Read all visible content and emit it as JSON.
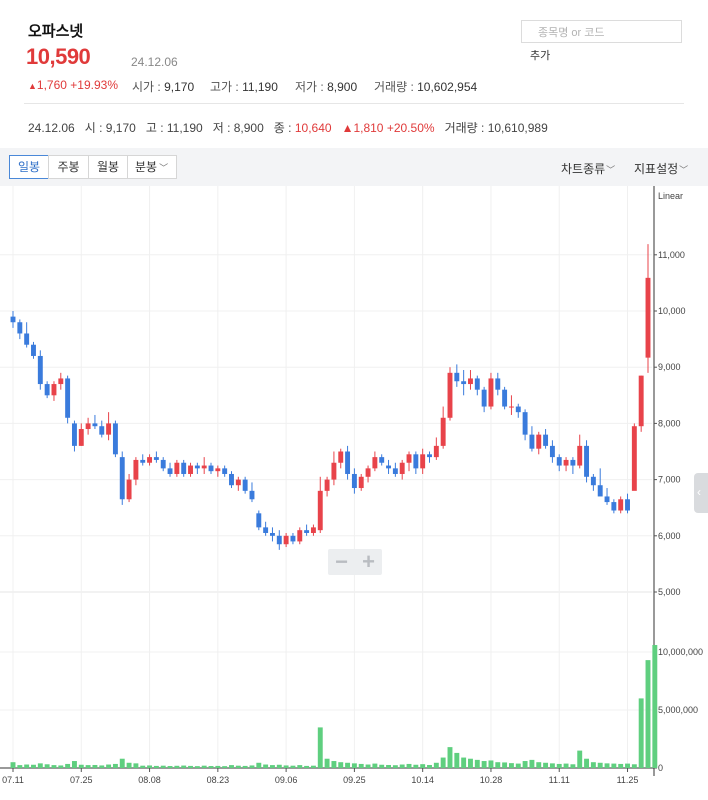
{
  "stock": {
    "name": "오파스넷",
    "price": "10,590",
    "date": "24.12.06",
    "change_arrow": "▲",
    "change_amount": "1,760",
    "change_pct": "+19.93%"
  },
  "stats": {
    "open_label": "시가 : ",
    "open_value": "9,170",
    "high_label": "고가 : ",
    "high_value": "11,190",
    "low_label": "저가 : ",
    "low_value": "8,900",
    "volume_label": "거래량 : ",
    "volume_value": "10,602,954"
  },
  "search": {
    "placeholder": "종목명 or 코드",
    "add_label": "추가"
  },
  "summary": {
    "date": "24.12.06",
    "open_label": "시 : ",
    "open_value": "9,170",
    "high_label": "고 : ",
    "high_value": "11,190",
    "low_label": "저 : ",
    "low_value": "8,900",
    "close_label": "종 : ",
    "close_value": "10,640",
    "change_arrow": "▲",
    "change_amount": "1,810",
    "change_pct": "+20.50%",
    "volume_label": "거래량 : ",
    "volume_value": "10,610,989"
  },
  "tabs": {
    "daily": "일봉",
    "weekly": "주봉",
    "monthly": "월봉",
    "minute": "분봉"
  },
  "dropdowns": {
    "chart_type": "차트종류",
    "indicator": "지표설정"
  },
  "zoom": {
    "minus": "−",
    "plus": "+"
  },
  "colors": {
    "up": "#e8434a",
    "down": "#3a7bdc",
    "volume": "#5fcf7f",
    "accent": "#2f6fc8"
  },
  "chart_data": {
    "type": "candlestick",
    "scale_label": "Linear",
    "price_ylim": [
      5000,
      11700
    ],
    "price_ticks": [
      5000,
      6000,
      7000,
      8000,
      9000,
      10000,
      11000
    ],
    "price_tick_labels": [
      "5,000",
      "6,000",
      "7,000",
      "8,000",
      "9,000",
      "10,000",
      "11,000"
    ],
    "volume_ylim": [
      0,
      11000000
    ],
    "volume_ticks": [
      0,
      5000000,
      10000000
    ],
    "volume_tick_labels": [
      "0",
      "5,000,000",
      "10,000,000"
    ],
    "x_tick_labels": [
      "07.11",
      "07.25",
      "08.08",
      "08.23",
      "09.06",
      "09.25",
      "10.14",
      "10.28",
      "11.11",
      "11.25"
    ],
    "x_tick_index": [
      0,
      10,
      20,
      30,
      40,
      50,
      60,
      70,
      80,
      90
    ],
    "candles": [
      [
        9900,
        10000,
        9700,
        9800
      ],
      [
        9800,
        9850,
        9500,
        9600
      ],
      [
        9600,
        9800,
        9350,
        9400
      ],
      [
        9400,
        9450,
        9150,
        9200
      ],
      [
        9200,
        9300,
        8600,
        8700
      ],
      [
        8700,
        8750,
        8450,
        8500
      ],
      [
        8500,
        8750,
        8400,
        8700
      ],
      [
        8700,
        8900,
        8600,
        8800
      ],
      [
        8800,
        8850,
        8000,
        8100
      ],
      [
        8000,
        8050,
        7500,
        7600
      ],
      [
        7600,
        8000,
        7600,
        7900
      ],
      [
        7900,
        8100,
        7800,
        8000
      ],
      [
        8000,
        8150,
        7900,
        7950
      ],
      [
        7950,
        8050,
        7750,
        7800
      ],
      [
        7800,
        8200,
        7700,
        8000
      ],
      [
        8000,
        8050,
        7400,
        7450
      ],
      [
        7400,
        7500,
        6550,
        6650
      ],
      [
        6650,
        7100,
        6600,
        7000
      ],
      [
        7000,
        7400,
        6900,
        7350
      ],
      [
        7350,
        7450,
        7250,
        7300
      ],
      [
        7300,
        7450,
        7250,
        7400
      ],
      [
        7400,
        7500,
        7300,
        7350
      ],
      [
        7350,
        7400,
        7150,
        7200
      ],
      [
        7200,
        7300,
        7050,
        7100
      ],
      [
        7100,
        7350,
        7050,
        7300
      ],
      [
        7300,
        7350,
        7050,
        7100
      ],
      [
        7100,
        7300,
        7050,
        7250
      ],
      [
        7250,
        7300,
        7100,
        7200
      ],
      [
        7200,
        7400,
        7100,
        7250
      ],
      [
        7250,
        7300,
        7100,
        7150
      ],
      [
        7150,
        7250,
        7050,
        7200
      ],
      [
        7200,
        7250,
        7050,
        7100
      ],
      [
        7100,
        7150,
        6850,
        6900
      ],
      [
        6900,
        7050,
        6800,
        7000
      ],
      [
        7000,
        7050,
        6750,
        6800
      ],
      [
        6800,
        6950,
        6600,
        6650
      ],
      [
        6400,
        6450,
        6100,
        6150
      ],
      [
        6150,
        6250,
        6000,
        6050
      ],
      [
        6050,
        6150,
        5900,
        6000
      ],
      [
        6000,
        6100,
        5750,
        5850
      ],
      [
        5850,
        6050,
        5800,
        6000
      ],
      [
        6000,
        6050,
        5850,
        5900
      ],
      [
        5900,
        6150,
        5850,
        6100
      ],
      [
        6100,
        6200,
        6000,
        6050
      ],
      [
        6050,
        6200,
        6000,
        6150
      ],
      [
        6100,
        7050,
        6050,
        6800
      ],
      [
        6800,
        7050,
        6700,
        7000
      ],
      [
        7000,
        7500,
        6900,
        7300
      ],
      [
        7300,
        7550,
        7200,
        7500
      ],
      [
        7500,
        7600,
        7000,
        7100
      ],
      [
        7100,
        7200,
        6750,
        6850
      ],
      [
        6850,
        7100,
        6800,
        7050
      ],
      [
        7050,
        7250,
        6950,
        7200
      ],
      [
        7200,
        7500,
        7150,
        7400
      ],
      [
        7400,
        7450,
        7250,
        7300
      ],
      [
        7250,
        7350,
        7100,
        7200
      ],
      [
        7200,
        7300,
        7050,
        7100
      ],
      [
        7100,
        7350,
        7000,
        7300
      ],
      [
        7300,
        7500,
        7150,
        7450
      ],
      [
        7450,
        7500,
        7100,
        7200
      ],
      [
        7200,
        7550,
        7100,
        7450
      ],
      [
        7450,
        7500,
        7300,
        7400
      ],
      [
        7400,
        7750,
        7350,
        7600
      ],
      [
        7600,
        8300,
        7550,
        8100
      ],
      [
        8100,
        9000,
        8050,
        8900
      ],
      [
        8900,
        9050,
        8650,
        8750
      ],
      [
        8750,
        8950,
        8500,
        8700
      ],
      [
        8700,
        8950,
        8600,
        8800
      ],
      [
        8800,
        8850,
        8500,
        8600
      ],
      [
        8600,
        8650,
        8200,
        8300
      ],
      [
        8300,
        8900,
        8250,
        8800
      ],
      [
        8800,
        8900,
        8500,
        8600
      ],
      [
        8600,
        8650,
        8250,
        8300
      ],
      [
        8300,
        8500,
        8150,
        8300
      ],
      [
        8300,
        8350,
        8100,
        8200
      ],
      [
        8200,
        8250,
        7700,
        7800
      ],
      [
        7800,
        7950,
        7500,
        7550
      ],
      [
        7550,
        7850,
        7450,
        7800
      ],
      [
        7800,
        7900,
        7550,
        7600
      ],
      [
        7600,
        7700,
        7300,
        7400
      ],
      [
        7400,
        7450,
        7150,
        7250
      ],
      [
        7250,
        7400,
        7150,
        7350
      ],
      [
        7350,
        7400,
        7100,
        7250
      ],
      [
        7250,
        7800,
        7200,
        7600
      ],
      [
        7600,
        7700,
        6950,
        7050
      ],
      [
        7050,
        7100,
        6800,
        6900
      ],
      [
        6900,
        7200,
        6750,
        6700
      ],
      [
        6700,
        6850,
        6550,
        6600
      ],
      [
        6600,
        6650,
        6400,
        6450
      ],
      [
        6450,
        6700,
        6400,
        6650
      ],
      [
        6650,
        6750,
        6400,
        6450
      ],
      [
        6800,
        8000,
        7300,
        7950
      ],
      [
        7950,
        8850,
        7850,
        8850
      ],
      [
        9170,
        11190,
        8900,
        10590
      ]
    ],
    "volumes": [
      500000,
      250000,
      300000,
      280000,
      400000,
      320000,
      250000,
      220000,
      350000,
      600000,
      280000,
      250000,
      260000,
      220000,
      300000,
      350000,
      800000,
      450000,
      400000,
      200000,
      220000,
      180000,
      200000,
      170000,
      190000,
      210000,
      180000,
      160000,
      200000,
      170000,
      180000,
      160000,
      250000,
      200000,
      180000,
      220000,
      450000,
      300000,
      250000,
      280000,
      220000,
      200000,
      250000,
      180000,
      200000,
      3500000,
      800000,
      600000,
      500000,
      450000,
      400000,
      350000,
      300000,
      380000,
      280000,
      260000,
      240000,
      300000,
      350000,
      280000,
      330000,
      260000,
      450000,
      900000,
      1800000,
      1300000,
      900000,
      800000,
      700000,
      600000,
      650000,
      500000,
      480000,
      420000,
      380000,
      600000,
      700000,
      500000,
      450000,
      400000,
      350000,
      380000,
      320000,
      1500000,
      800000,
      500000,
      450000,
      400000,
      380000,
      350000,
      380000,
      320000,
      6000000,
      9300000,
      10602954
    ]
  }
}
